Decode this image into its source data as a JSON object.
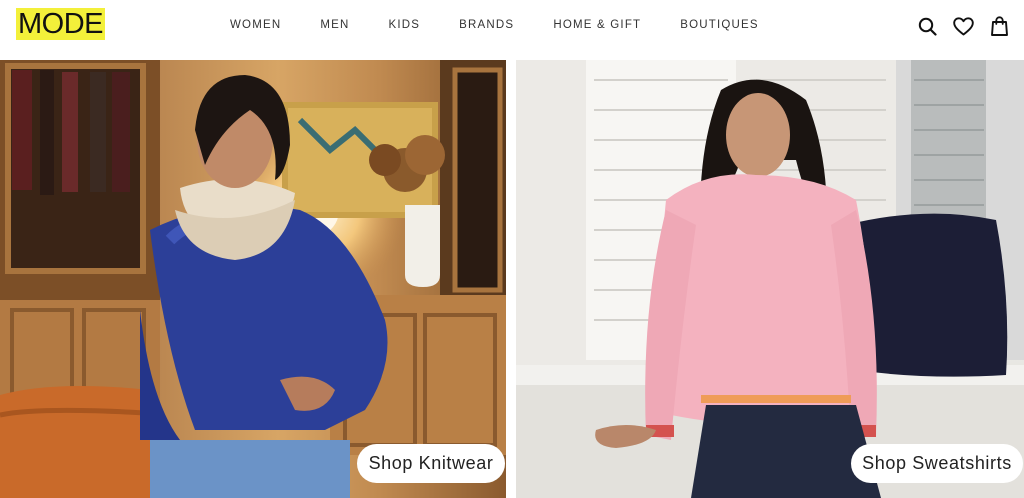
{
  "brand": {
    "logo_text": "MODE",
    "logo_highlight": "#f3f03a"
  },
  "nav": {
    "items": [
      {
        "label": "WOMEN"
      },
      {
        "label": "MEN"
      },
      {
        "label": "KIDS"
      },
      {
        "label": "BRANDS"
      },
      {
        "label": "HOME & GIFT"
      },
      {
        "label": "BOUTIQUES"
      }
    ]
  },
  "header_icons": [
    "search-icon",
    "heart-icon",
    "shopping-bag-icon"
  ],
  "hero": {
    "left": {
      "cta_label": "Shop Knitwear"
    },
    "right": {
      "cta_label": "Shop Sweatshirts"
    }
  }
}
